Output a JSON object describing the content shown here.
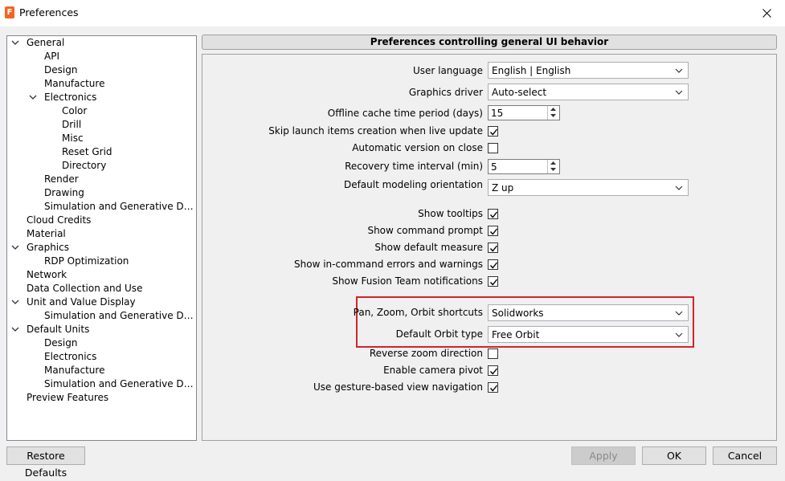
{
  "window": {
    "title": "Preferences",
    "app_icon_letter": "F"
  },
  "tree": [
    {
      "label": "General",
      "level": 0,
      "expanded": true
    },
    {
      "label": "API",
      "level": 1
    },
    {
      "label": "Design",
      "level": 1
    },
    {
      "label": "Manufacture",
      "level": 1
    },
    {
      "label": "Electronics",
      "level": 1,
      "expanded": true
    },
    {
      "label": "Color",
      "level": 2
    },
    {
      "label": "Drill",
      "level": 2
    },
    {
      "label": "Misc",
      "level": 2
    },
    {
      "label": "Reset Grid",
      "level": 2
    },
    {
      "label": "Directory",
      "level": 2
    },
    {
      "label": "Render",
      "level": 1
    },
    {
      "label": "Drawing",
      "level": 1
    },
    {
      "label": "Simulation and Generative Des…",
      "level": 1
    },
    {
      "label": "Cloud Credits",
      "level": 0
    },
    {
      "label": "Material",
      "level": 0
    },
    {
      "label": "Graphics",
      "level": 0,
      "expanded": true
    },
    {
      "label": "RDP Optimization",
      "level": 1
    },
    {
      "label": "Network",
      "level": 0
    },
    {
      "label": "Data Collection and Use",
      "level": 0
    },
    {
      "label": "Unit and Value Display",
      "level": 0,
      "expanded": true
    },
    {
      "label": "Simulation and Generative Des…",
      "level": 1
    },
    {
      "label": "Default Units",
      "level": 0,
      "expanded": true
    },
    {
      "label": "Design",
      "level": 1
    },
    {
      "label": "Electronics",
      "level": 1
    },
    {
      "label": "Manufacture",
      "level": 1
    },
    {
      "label": "Simulation and Generative Des…",
      "level": 1
    },
    {
      "label": "Preview Features",
      "level": 0
    }
  ],
  "panel": {
    "header": "Preferences controlling general UI behavior",
    "user_language": {
      "label": "User language",
      "value": "English | English"
    },
    "graphics_driver": {
      "label": "Graphics driver",
      "value": "Auto-select"
    },
    "offline_cache": {
      "label": "Offline cache time period (days)",
      "value": "15"
    },
    "skip_launch": {
      "label": "Skip launch items creation when live update",
      "checked": true
    },
    "auto_version": {
      "label": "Automatic version on close",
      "checked": false
    },
    "recovery_interval": {
      "label": "Recovery time interval (min)",
      "value": "5"
    },
    "modeling_orientation": {
      "label": "Default modeling orientation",
      "value": "Z up"
    },
    "show_tooltips": {
      "label": "Show tooltips",
      "checked": true
    },
    "show_command_prompt": {
      "label": "Show command prompt",
      "checked": true
    },
    "show_default_measure": {
      "label": "Show default measure",
      "checked": true
    },
    "show_errors": {
      "label": "Show in-command errors and warnings",
      "checked": true
    },
    "show_team_notifications": {
      "label": "Show Fusion Team notifications",
      "checked": true
    },
    "pan_zoom_orbit": {
      "label": "Pan, Zoom, Orbit shortcuts",
      "value": "Solidworks"
    },
    "orbit_type": {
      "label": "Default Orbit type",
      "value": "Free Orbit"
    },
    "reverse_zoom": {
      "label": "Reverse zoom direction",
      "checked": false
    },
    "camera_pivot": {
      "label": "Enable camera pivot",
      "checked": true
    },
    "gesture_nav": {
      "label": "Use gesture-based view navigation",
      "checked": true
    }
  },
  "buttons": {
    "restore": "Restore Defaults",
    "apply": "Apply",
    "ok": "OK",
    "cancel": "Cancel"
  },
  "colors": {
    "highlight": "#d4232e",
    "app_icon": "#f26522"
  }
}
